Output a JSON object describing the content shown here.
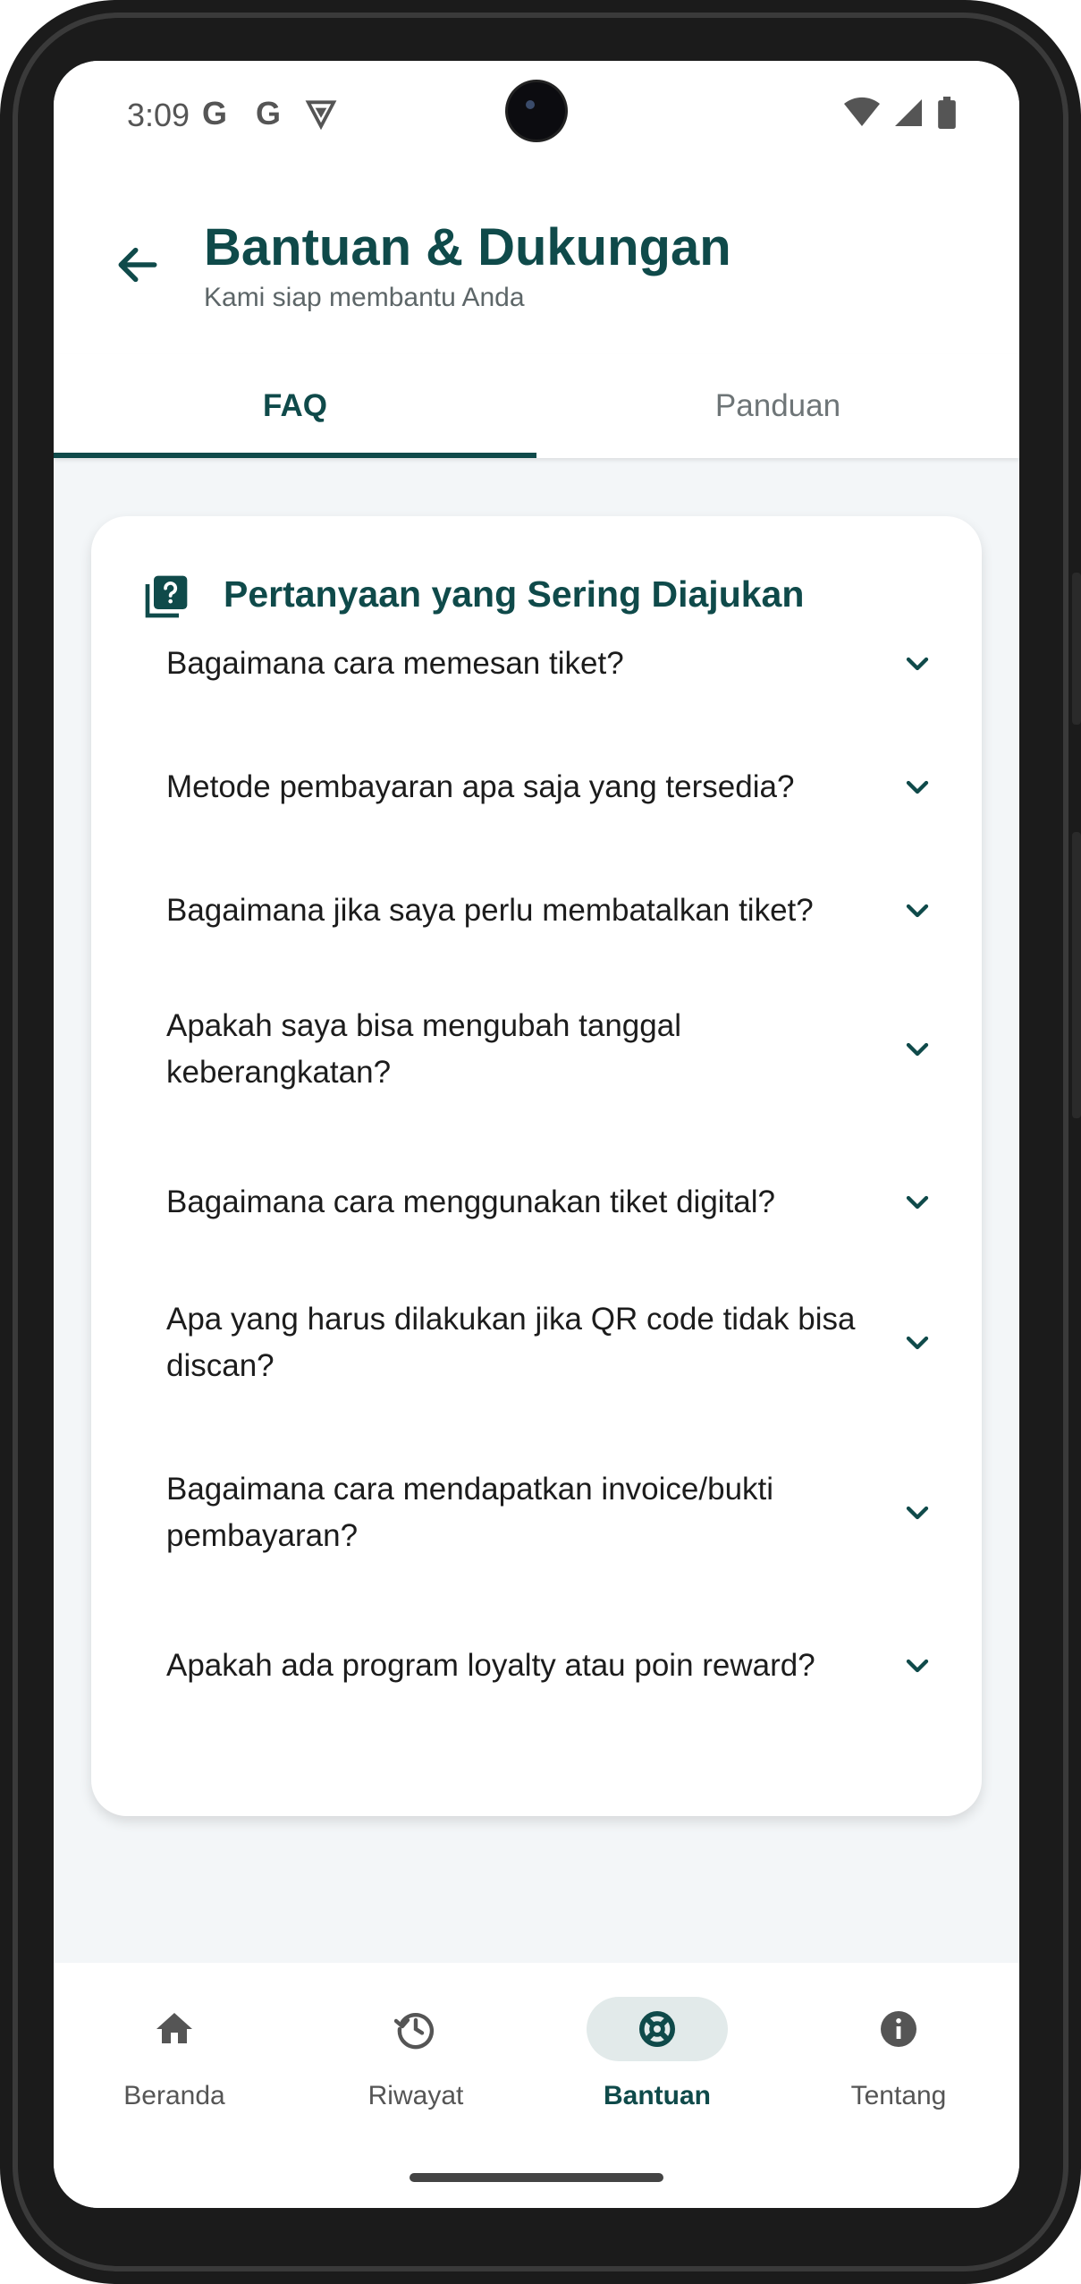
{
  "status": {
    "time": "3:09",
    "left_icons": [
      "G",
      "G"
    ]
  },
  "header": {
    "title": "Bantuan & Dukungan",
    "subtitle": "Kami siap membantu Anda"
  },
  "tabs": [
    {
      "label": "FAQ",
      "active": true
    },
    {
      "label": "Panduan",
      "active": false
    }
  ],
  "faq": {
    "title": "Pertanyaan yang Sering Diajukan",
    "items": [
      {
        "q": "Bagaimana cara memesan tiket?"
      },
      {
        "q": "Metode pembayaran apa saja yang tersedia?"
      },
      {
        "q": "Bagaimana jika saya perlu membatalkan tiket?"
      },
      {
        "q": "Apakah saya bisa mengubah tanggal keberangkatan?"
      },
      {
        "q": "Bagaimana cara menggunakan tiket digital?"
      },
      {
        "q": "Apa yang harus dilakukan jika QR code tidak bisa discan?"
      },
      {
        "q": "Bagaimana cara mendapatkan invoice/bukti pembayaran?"
      },
      {
        "q": "Apakah ada program loyalty atau poin reward?"
      }
    ]
  },
  "nav": [
    {
      "label": "Beranda",
      "icon": "home-icon",
      "active": false
    },
    {
      "label": "Riwayat",
      "icon": "history-icon",
      "active": false
    },
    {
      "label": "Bantuan",
      "icon": "support-icon",
      "active": true
    },
    {
      "label": "Tentang",
      "icon": "info-icon",
      "active": false
    }
  ],
  "colors": {
    "primary": "#0f4a4a",
    "background": "#f3f6f8",
    "card": "#ffffff",
    "active_pill": "#e2eaea"
  }
}
